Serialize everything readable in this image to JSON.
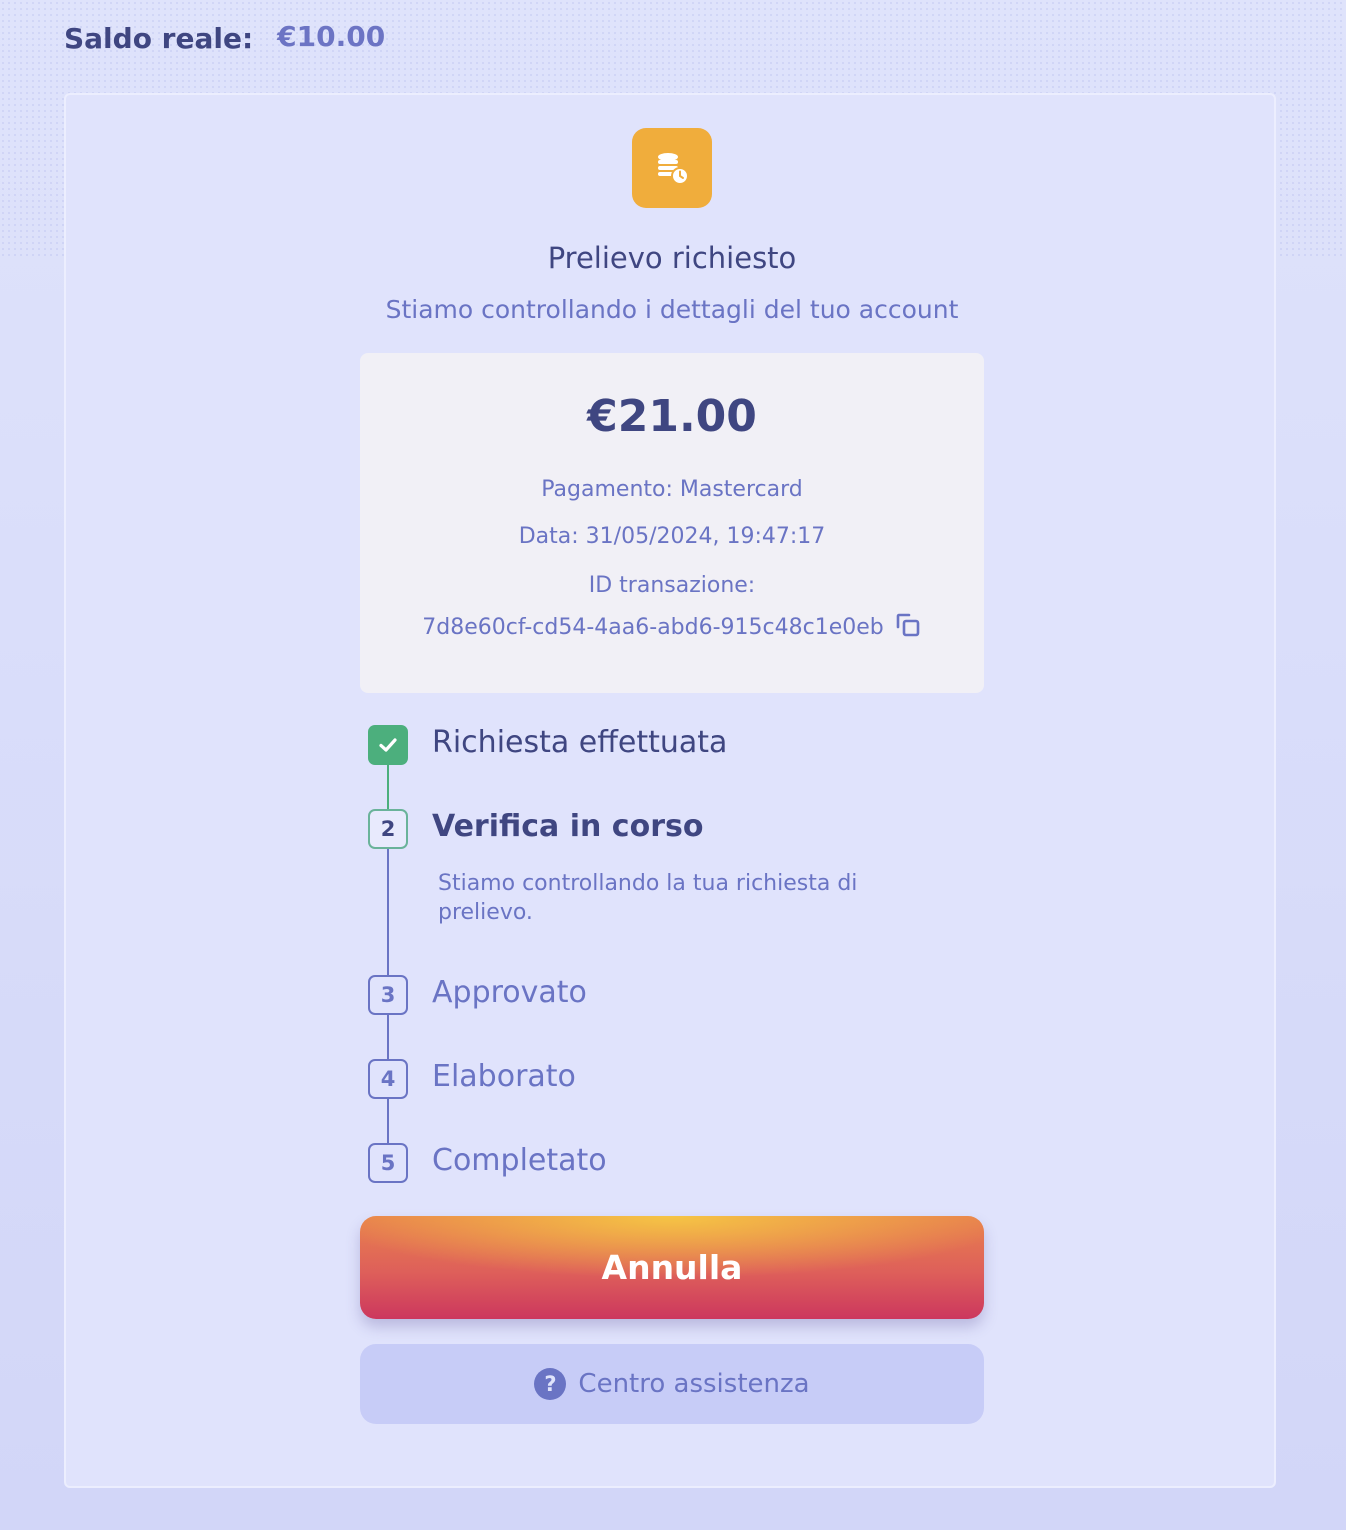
{
  "balance": {
    "label": "Saldo reale:",
    "value": "€10.00"
  },
  "withdrawal": {
    "icon": "coins-clock-icon",
    "title": "Prelievo richiesto",
    "subtitle": "Stiamo controllando i dettagli del tuo account",
    "amount": "€21.00",
    "payment": "Pagamento: Mastercard",
    "date": "Data: 31/05/2024, 19:47:17",
    "transaction_label": "ID transazione:",
    "transaction_id": "7d8e60cf-cd54-4aa6-abd6-915c48c1e0eb"
  },
  "steps": [
    {
      "number": "1",
      "label": "Richiesta effettuata",
      "state": "done"
    },
    {
      "number": "2",
      "label": "Verifica in corso",
      "state": "active",
      "description": "Stiamo controllando la tua richiesta di prelievo."
    },
    {
      "number": "3",
      "label": "Approvato",
      "state": "pending"
    },
    {
      "number": "4",
      "label": "Elaborato",
      "state": "pending"
    },
    {
      "number": "5",
      "label": "Completato",
      "state": "pending"
    }
  ],
  "actions": {
    "cancel_label": "Annulla",
    "help_label": "Centro assistenza",
    "help_icon": "?"
  },
  "colors": {
    "accent": "#6a74c4",
    "text_dark": "#3f4681",
    "status_icon_bg": "#f0ad3c",
    "success": "#4caf7d"
  }
}
